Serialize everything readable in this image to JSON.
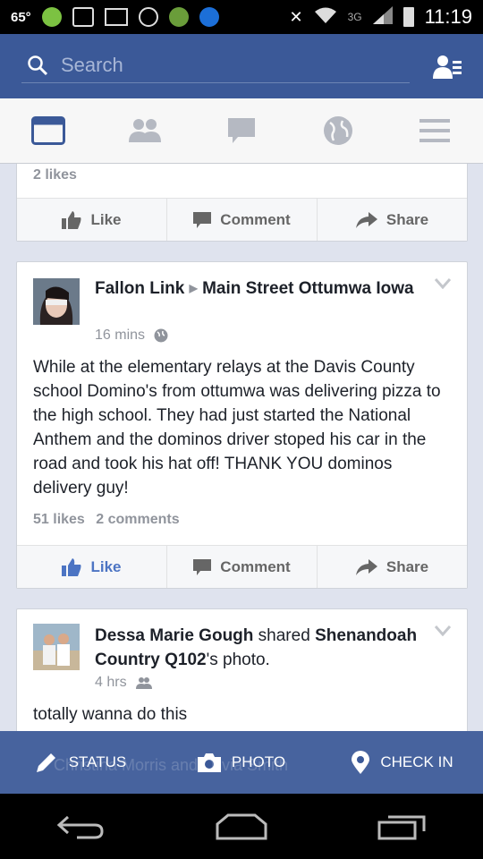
{
  "status_bar": {
    "temperature": "65°",
    "network": "3G",
    "time": "11:19"
  },
  "search": {
    "placeholder": "Search"
  },
  "tabs": [
    {
      "icon": "news-feed-icon",
      "active": true
    },
    {
      "icon": "friends-icon",
      "active": false
    },
    {
      "icon": "messages-icon",
      "active": false
    },
    {
      "icon": "notifications-globe-icon",
      "active": false
    },
    {
      "icon": "menu-icon",
      "active": false
    }
  ],
  "post0": {
    "likes": "2 likes",
    "actions": {
      "like": "Like",
      "comment": "Comment",
      "share": "Share"
    }
  },
  "post1": {
    "author": "Fallon Link",
    "target": "Main Street Ottumwa Iowa",
    "time": "16 mins",
    "text": "While at the elementary relays at the Davis County school Domino's from ottumwa was delivering pizza to the high school. They had just started the National Anthem and the dominos driver stoped his car in the road and took his hat off! THANK YOU dominos delivery guy!",
    "likes": "51 likes",
    "comments": "2 comments",
    "actions": {
      "like": "Like",
      "comment": "Comment",
      "share": "Share"
    }
  },
  "post2": {
    "author": "Dessa Marie Gough",
    "shared": "shared",
    "source": "Shenandoah Country Q102",
    "suffix": "'s photo.",
    "time": "4 hrs",
    "text": "totally wanna do this"
  },
  "bottom_bar": {
    "status": "STATUS",
    "photo": "PHOTO",
    "checkin": "CHECK IN",
    "underlay": "Christina Morris and Olivia Smith"
  },
  "colors": {
    "brand": "#3b5998",
    "liked": "#4c74c3"
  }
}
